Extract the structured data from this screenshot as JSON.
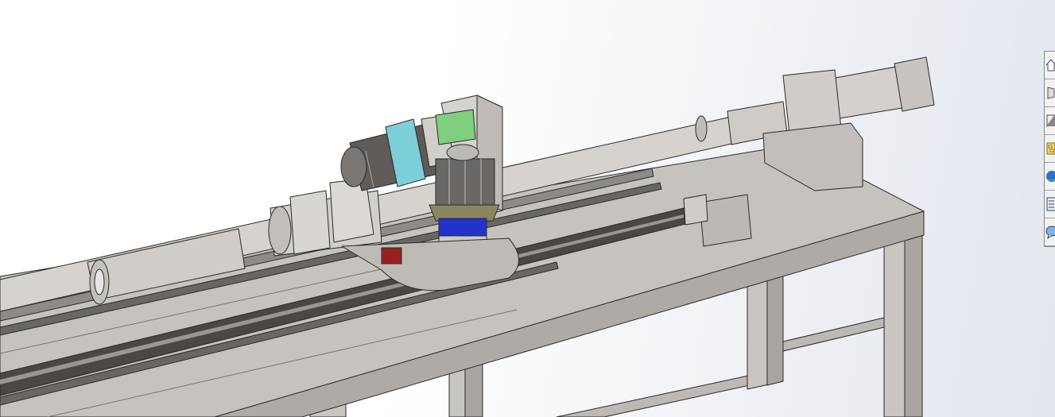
{
  "viewport": {
    "model": "cad-assembly-render",
    "colors": {
      "body": "#c8c4c0",
      "edge": "#2b2b2b",
      "motor_coupler": "#2233cc",
      "adapter_teal": "#7ccfd8",
      "bracket_green": "#7fcf7f",
      "clamp_red": "#9a2020",
      "flange_olive": "#8a8660"
    }
  },
  "task_pane": {
    "tabs": [
      {
        "icon": "home-icon"
      },
      {
        "icon": "3d-part-icon"
      },
      {
        "icon": "design-library-icon"
      },
      {
        "icon": "file-explorer-icon"
      },
      {
        "icon": "globe-icon"
      },
      {
        "icon": "custom-properties-icon"
      },
      {
        "icon": "forum-icon"
      }
    ]
  }
}
